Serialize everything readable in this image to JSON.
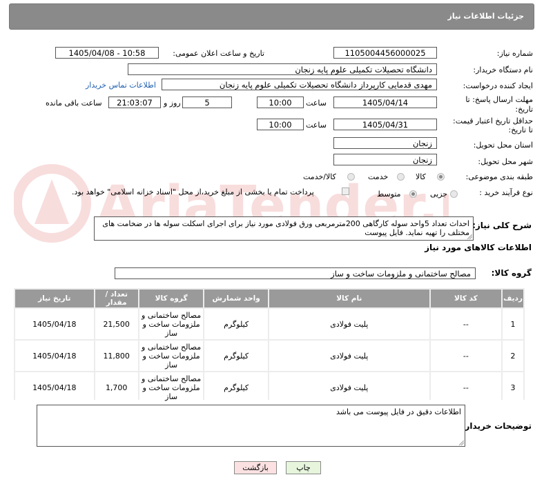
{
  "header": {
    "title": "جزئیات اطلاعات نیاز"
  },
  "fields": {
    "need_number_label": "شماره نیاز:",
    "need_number": "1105004456000025",
    "announce_label": "تاریخ و ساعت اعلان عمومی:",
    "announce_value": "1405/04/08 - 10:58",
    "buyer_org_label": "نام دستگاه خریدار:",
    "buyer_org": "دانشگاه تحصیلات تکمیلی علوم پایه زنجان",
    "requester_label": "ایجاد کننده درخواست:",
    "requester": "مهدی قدمایی کارپرداز دانشگاه تحصیلات تکمیلی علوم پایه زنجان",
    "contact_link": "اطلاعات تماس خریدار",
    "deadline_label_1": "مهلت ارسال پاسخ: تا",
    "deadline_label_2": "تاریخ:",
    "deadline_date": "1405/04/14",
    "time_label": "ساعت",
    "deadline_time": "10:00",
    "days_value": "5",
    "days_label": "روز و",
    "remaining_time": "21:03:07",
    "remaining_label": "ساعت باقی مانده",
    "validity_label_1": "حداقل تاریخ اعتبار قیمت:",
    "validity_label_2": "تا تاریخ:",
    "validity_date": "1405/04/31",
    "validity_time": "10:00",
    "province_label": "استان محل تحویل:",
    "province": "زنجان",
    "city_label": "شهر محل تحویل:",
    "city": "زنجان",
    "category_label": "طبقه بندی موضوعی:",
    "category_options": [
      "کالا",
      "خدمت",
      "کالا/خدمت"
    ],
    "process_label": "نوع فرآیند خرید :",
    "process_options": [
      "جزیی",
      "متوسط"
    ],
    "payment_note": "پرداخت تمام یا بخشی از مبلغ خرید،از محل \"اسناد خزانه اسلامی\" خواهد بود.",
    "description_label": "شرح کلی نیاز:",
    "description": "احداث تعداد  5واحد سوله کارگاهی  200مترمربعی ورق فولادی مورد نیاز برای اجرای اسکلت سوله ها در ضخامت های مختلف را تهیه نماید. فایل پیوست"
  },
  "goods": {
    "section_title": "اطلاعات کالاهای مورد نیاز",
    "group_label": "گروه کالا:",
    "group_value": "مصالح ساختمانی و ملزومات ساخت و ساز",
    "columns": [
      "ردیف",
      "کد کالا",
      "نام کالا",
      "واحد شمارش",
      "گروه کالا",
      "تعداد / مقدار",
      "تاریخ نیاز"
    ],
    "rows": [
      {
        "idx": "1",
        "code": "--",
        "name": "پلیت فولادی",
        "unit": "کیلوگرم",
        "group": "مصالح ساختمانی و ملزومات ساخت و ساز",
        "qty": "21,500",
        "date": "1405/04/18"
      },
      {
        "idx": "2",
        "code": "--",
        "name": "پلیت فولادی",
        "unit": "کیلوگرم",
        "group": "مصالح ساختمانی و ملزومات ساخت و ساز",
        "qty": "11,800",
        "date": "1405/04/18"
      },
      {
        "idx": "3",
        "code": "--",
        "name": "پلیت فولادی",
        "unit": "کیلوگرم",
        "group": "مصالح ساختمانی و ملزومات ساخت و ساز",
        "qty": "1,700",
        "date": "1405/04/18"
      }
    ]
  },
  "buyer_notes": {
    "label": "توضیحات خریدار:",
    "text": "اطلاعات دقیق در فایل پیوست می باشد"
  },
  "buttons": {
    "print": "چاپ",
    "back": "بازگشت"
  },
  "colors": {
    "header_bg": "#8a8a8a",
    "link": "#1f5fb0",
    "print_btn": "#e6f5dc",
    "back_btn": "#fbe1e1"
  },
  "watermark_text": "AriaTender.neT"
}
